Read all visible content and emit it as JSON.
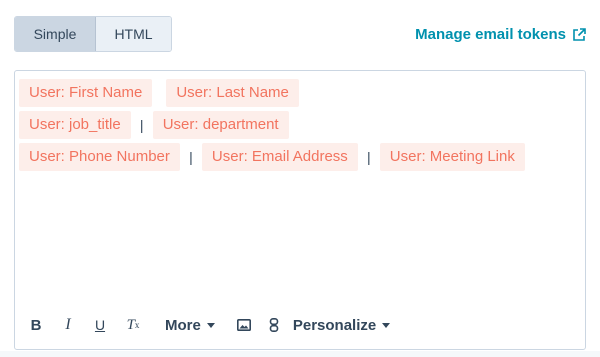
{
  "mode_toggle": {
    "simple_label": "Simple",
    "html_label": "HTML"
  },
  "manage_link": {
    "label": "Manage email tokens",
    "icon": "external-link-icon"
  },
  "tokens": {
    "row1": [
      "User: First Name",
      "User: Last Name"
    ],
    "row2": [
      "User: job_title",
      "User: department"
    ],
    "row3": [
      "User: Phone Number",
      "User: Email Address",
      "User: Meeting Link"
    ]
  },
  "separator": "|",
  "toolbar": {
    "bold": "B",
    "italic": "I",
    "underline": "U",
    "clear_format": "T",
    "clear_format_sub": "x",
    "more_label": "More",
    "personalize_label": "Personalize"
  },
  "colors": {
    "accent": "#0091ae",
    "token_text": "#f2745f",
    "token_bg": "#fdeeea",
    "text": "#33475b",
    "border": "#cbd6e2"
  }
}
